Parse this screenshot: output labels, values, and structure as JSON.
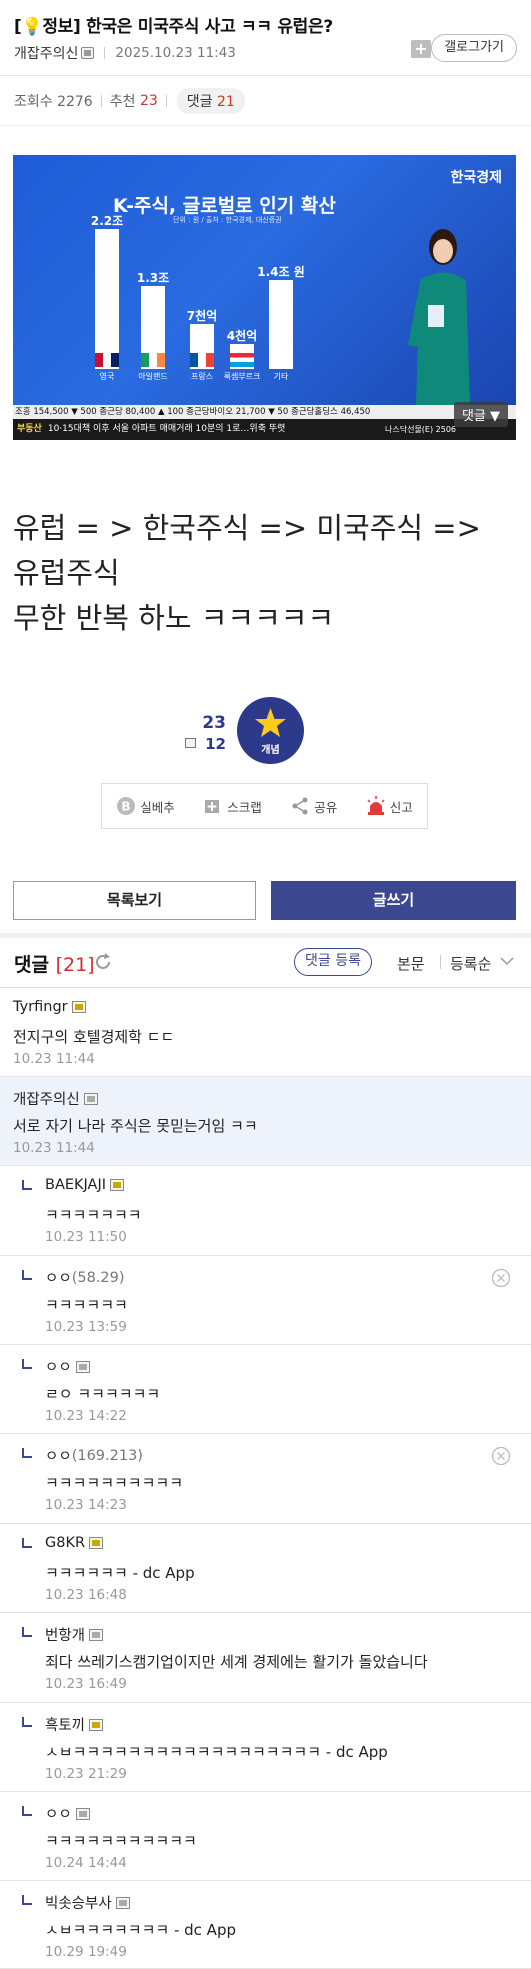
{
  "post": {
    "category": "[💡정보]",
    "title": "한국은 미국주식 사고 ㅋㅋ 유럽은?",
    "author": "개잡주의신",
    "date": "2025.10.23 11:43",
    "gallery_button": "갤로그가기",
    "plus_label": "+"
  },
  "stats": {
    "views_label": "조회수 2276",
    "reco_label": "추천",
    "reco_count": "23",
    "comments_label": "댓글",
    "comments_count": "21"
  },
  "video": {
    "brand": "한국경제",
    "chart_title": "K-주식, 글로벌로 인기 확산",
    "chart_sub": "단위 : 원 / 출처 : 한국경제, 대신증권",
    "ticker1": "조흥 154,500 ▼ 500     종근당 80,400 ▲ 100     종근당바이오 21,700 ▼ 50     종근당홀딩스 46,450",
    "ticker_tag": "부동산",
    "ticker2": "10·15대책 이후 서울 아파트 매매거래 10분의 1로…위축 뚜렷",
    "ticker_right": "나스닥선물(E) 2506",
    "comment_btn": "댓글 ▼"
  },
  "chart_data": {
    "type": "bar",
    "title": "K-주식, 글로벌로 인기 확산",
    "categories": [
      "영국",
      "아일랜드",
      "프랑스",
      "룩셈부르크",
      "기타"
    ],
    "value_labels": [
      "2.2조",
      "1.3조",
      "7천억",
      "4천억",
      "1.4조 원"
    ],
    "values": [
      22000,
      13000,
      7000,
      4000,
      14000
    ],
    "ylabel": "억 원",
    "ylim": [
      0,
      22000
    ],
    "grid": false
  },
  "body": {
    "line1": "유럽 = > 한국주식 => 미국주식 =>",
    "line2": "유럽주식",
    "line3": "무한 반복 하노 ㅋㅋㅋㅋㅋ"
  },
  "recommend": {
    "count": "23",
    "fixed_count": "12",
    "button": "개념"
  },
  "actions": {
    "silbe": "실베추",
    "scrap": "스크랩",
    "share": "공유",
    "report": "신고"
  },
  "buttons": {
    "list": "목록보기",
    "write": "글쓰기"
  },
  "comments_header": {
    "title": "댓글",
    "count": "[21]",
    "register": "댓글 등록",
    "body": "본문",
    "sort": "등록순"
  },
  "comments": [
    {
      "nick": "Tyrfingr",
      "ip": "",
      "text": "전지구의 호텔경제학 ㄷㄷ",
      "time": "10.23 11:44"
    },
    {
      "nick": "개잡주의신",
      "ip": "",
      "text": "서로 자기 나라 주식은 못믿는거임 ㅋㅋ",
      "time": "10.23 11:44"
    },
    {
      "nick": "BAEKJAJI",
      "ip": "",
      "text": "ㅋㅋㅋㅋㅋㅋㅋ",
      "time": "10.23 11:50"
    },
    {
      "nick": "ㅇㅇ",
      "ip": "(58.29)",
      "text": "ㅋㅋㅋㅋㅋㅋ",
      "time": "10.23 13:59"
    },
    {
      "nick": "ㅇㅇ",
      "ip": "",
      "text": "ㄹㅇ ㅋㅋㅋㅋㅋㅋ",
      "time": "10.23 14:22"
    },
    {
      "nick": "ㅇㅇ",
      "ip": "(169.213)",
      "text": "ㅋㅋㅋㅋㅋㅋㅋㅋㅋㅋ",
      "time": "10.23 14:23"
    },
    {
      "nick": "G8KR",
      "ip": "",
      "text": "ㅋㅋㅋㅋㅋㅋ - dc App",
      "time": "10.23 16:48"
    },
    {
      "nick": "번항개",
      "ip": "",
      "text": "죄다 쓰레기스캠기업이지만 세계 경제에는 활기가 돌았습니다",
      "time": "10.23 16:49"
    },
    {
      "nick": "흑토끼",
      "ip": "",
      "text": "ㅅㅂㅋㅋㅋㅋㅋㅋㅋㅋㅋㅋㅋㅋㅋㅋㅋㅋㅋㅋ - dc App",
      "time": "10.23 21:29"
    },
    {
      "nick": "ㅇㅇ",
      "ip": "",
      "text": "ㅋㅋㅋㅋㅋㅋㅋㅋㅋㅋㅋ",
      "time": "10.24 14:44"
    },
    {
      "nick": "빅솟승부사",
      "ip": "",
      "text": "ㅅㅂㅋㅋㅋㅋㅋㅋㅋ - dc App",
      "time": "10.29 19:49"
    }
  ]
}
